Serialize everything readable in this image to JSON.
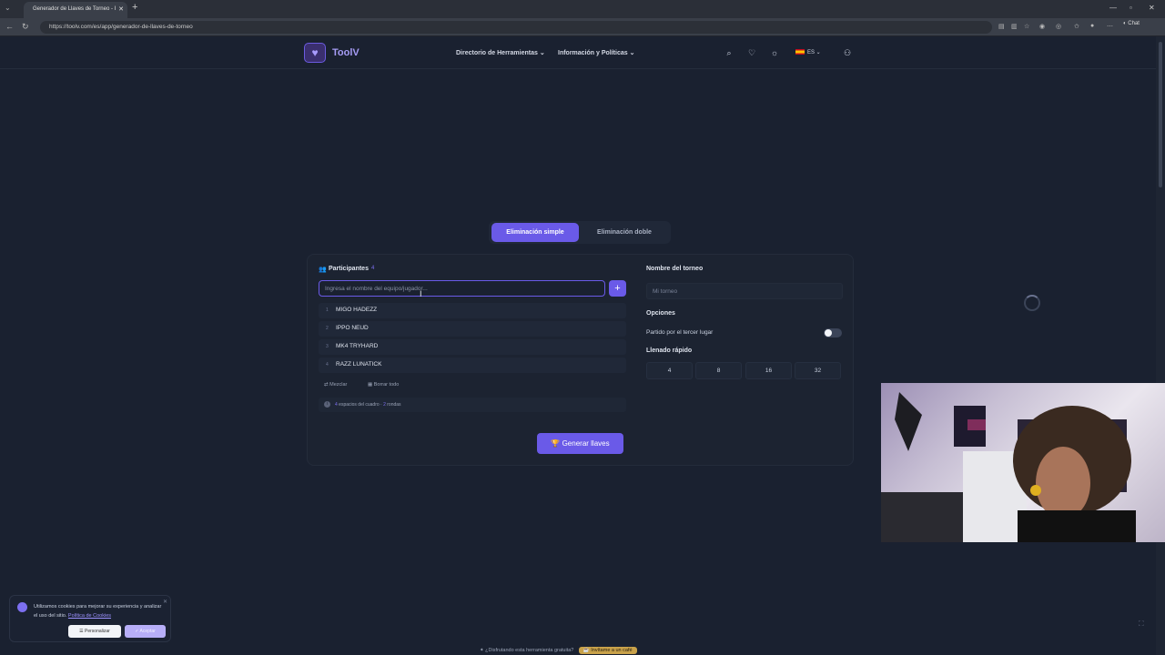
{
  "browser": {
    "tab_title": "Generador de Llaves de Torneo - I",
    "url": "https://toolv.com/es/app/generador-de-llaves-de-torneo",
    "chat_label": "Chat"
  },
  "header": {
    "logo_text": "ToolV",
    "nav": [
      {
        "label": "Directorio de Herramientas"
      },
      {
        "label": "Información y Políticas"
      }
    ],
    "lang": "ES"
  },
  "modes": {
    "active": "Eliminación simple",
    "inactive": "Eliminación doble"
  },
  "participants": {
    "title": "Participantes",
    "count": "4",
    "input_placeholder": "Ingresa el nombre del equipo/jugador...",
    "add_label": "+",
    "list": [
      {
        "num": "1",
        "name": "MIGO HADEZZ"
      },
      {
        "num": "2",
        "name": "IPPO NEUD"
      },
      {
        "num": "3",
        "name": "MK4 TRYHARD"
      },
      {
        "num": "4",
        "name": "RAZZ LUNATICK"
      }
    ],
    "shuffle_label": "Mezclar",
    "clear_label": "Borrar todo",
    "info": {
      "slots": "4",
      "slots_text": "espacios del cuadro ·",
      "rounds": "2",
      "rounds_text": "rondas"
    }
  },
  "settings": {
    "tournament_name_label": "Nombre del torneo",
    "tournament_name_placeholder": "Mi torneo",
    "options_label": "Opciones",
    "third_place_label": "Partido por el tercer lugar",
    "quick_fill_label": "Llenado rápido",
    "quick_fill": [
      "4",
      "8",
      "16",
      "32"
    ]
  },
  "generate_label": "Generar llaves",
  "cookie": {
    "text": "Utilizamos cookies para mejorar su experiencia y analizar el uso del sitio.",
    "policy_link": "Política de Cookies",
    "customize": "Personalizar",
    "accept": "Aceptar"
  },
  "footer": {
    "text": "¿Disfrutando esta herramienta gratuita?",
    "coffee": "Invítame a un café"
  },
  "colors": {
    "accent": "#6a5ae8",
    "background": "#1a2130",
    "card": "#1c2331"
  }
}
